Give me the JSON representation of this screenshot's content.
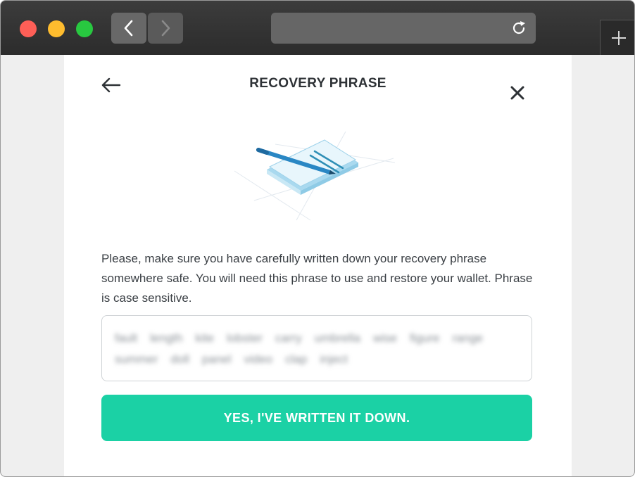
{
  "browser": {
    "traffic_lights": [
      "#fe5f57",
      "#febc2e",
      "#28c840"
    ],
    "icons": {
      "back": "chevron-left-icon",
      "forward": "chevron-right-icon",
      "reload": "reload-icon",
      "new_tab": "plus-icon"
    }
  },
  "modal": {
    "title": "RECOVERY PHRASE",
    "icons": {
      "back": "arrow-left-icon",
      "close": "close-icon",
      "illustration": "notepad-pen-illustration"
    },
    "description": "Please, make sure you have carefully written down your recovery phrase somewhere safe. You will need this phrase to use and restore your wallet. Phrase is case sensitive.",
    "phrase_words": [
      "fault",
      "length",
      "kite",
      "lobster",
      "carry",
      "umbrella",
      "wise",
      "figure",
      "range",
      "summer",
      "doll",
      "panel",
      "video",
      "clap",
      "inject"
    ],
    "confirm_button": "YES, I'VE WRITTEN IT DOWN.",
    "accent_color": "#1bd1a5"
  }
}
